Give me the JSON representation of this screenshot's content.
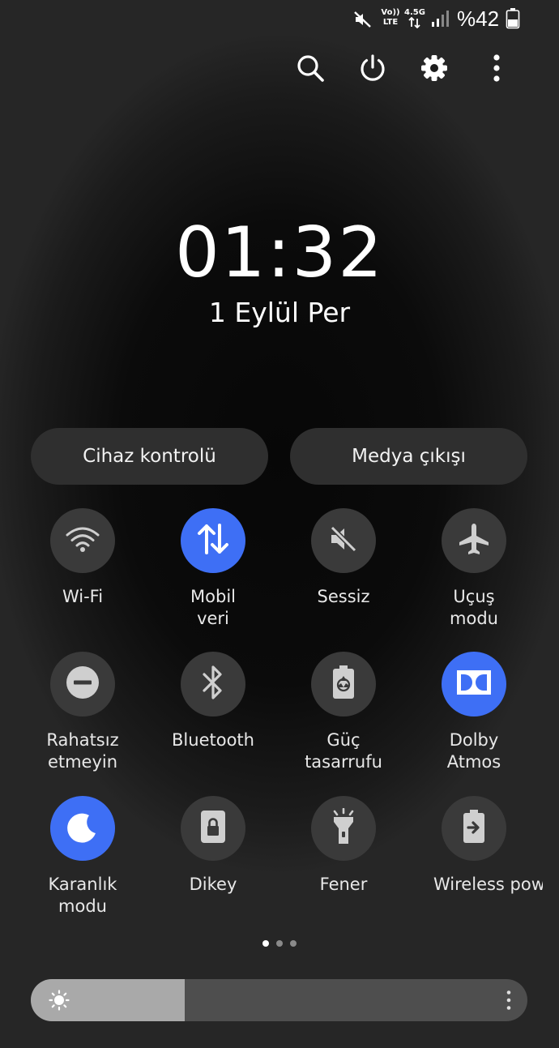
{
  "status_bar": {
    "icons": [
      "mute-icon",
      "volte-icon",
      "network-arrows-icon",
      "signal-icon",
      "battery-icon"
    ],
    "volte_top": "Vo))",
    "volte_bottom": "LTE",
    "network_type": "4.5G",
    "battery_text": "%42"
  },
  "top_actions": [
    {
      "name": "search-icon"
    },
    {
      "name": "power-icon"
    },
    {
      "name": "settings-gear-icon"
    },
    {
      "name": "more-options-icon"
    }
  ],
  "clock": {
    "time": "01:32",
    "date": "1 Eylül Per"
  },
  "pills": {
    "device_control": "Cihaz kontrolü",
    "media_output": "Medya çıkışı"
  },
  "tiles": [
    {
      "label": "Wi-Fi",
      "icon": "wifi-icon",
      "active": false
    },
    {
      "label": "Mobil\nveri",
      "icon": "mobile-data-icon",
      "active": true
    },
    {
      "label": "Sessiz",
      "icon": "mute-icon",
      "active": false
    },
    {
      "label": "Uçuş\nmodu",
      "icon": "airplane-icon",
      "active": false
    },
    {
      "label": "Rahatsız\netmeyin",
      "icon": "do-not-disturb-icon",
      "active": false
    },
    {
      "label": "Bluetooth",
      "icon": "bluetooth-icon",
      "active": false
    },
    {
      "label": "Güç\ntasarrufu",
      "icon": "power-saving-icon",
      "active": false
    },
    {
      "label": "Dolby\nAtmos",
      "icon": "dolby-icon",
      "active": true
    },
    {
      "label": "Karanlık\nmodu",
      "icon": "dark-mode-icon",
      "active": true
    },
    {
      "label": "Dikey",
      "icon": "portrait-lock-icon",
      "active": false
    },
    {
      "label": "Fener",
      "icon": "flashlight-icon",
      "active": false
    },
    {
      "label": "Wireless power sharing",
      "icon": "wireless-power-icon",
      "active": false
    }
  ],
  "pagination": {
    "pages": 3,
    "current": 1
  },
  "brightness": {
    "level_fraction": 0.31,
    "icon": "sun-icon",
    "more_icon": "more-options-icon"
  },
  "colors": {
    "accent": "#3e6ff5",
    "tile_inactive": "#3a3a3a",
    "background": "#282828"
  }
}
